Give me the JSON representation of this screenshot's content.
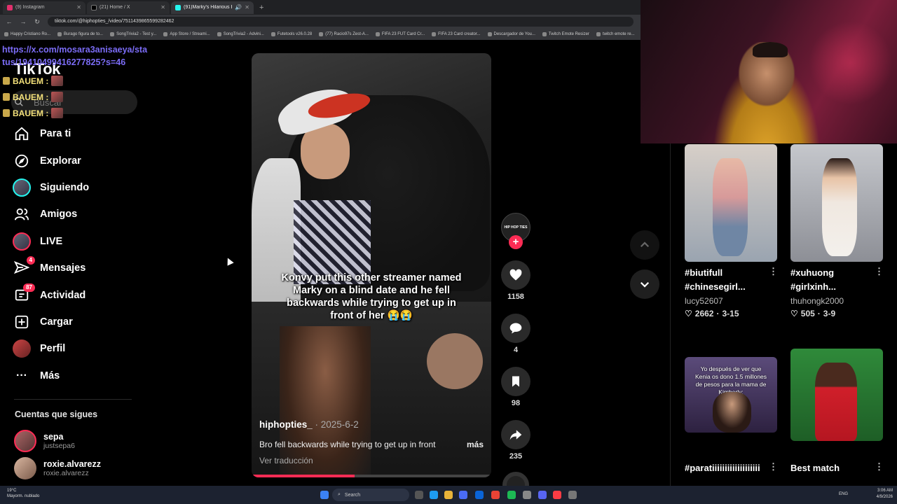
{
  "browser": {
    "tabs": [
      {
        "label": "(9) Instagram",
        "color": "#e1306c"
      },
      {
        "label": "(21) Home / X",
        "color": "#000000"
      },
      {
        "label": "(91)Marky's Hilarious Blind",
        "color": "#25f4ee"
      }
    ],
    "url": "tiktok.com/@hiphopties_/video/7511439865599282462",
    "bookmarks": [
      "Happy Cristiano Ro...",
      "Burago figura de to...",
      "SongTrivia2 - Test y...",
      "App Store / Streami...",
      "SongTrivia2 - Advini...",
      "Futetools v26.0.28",
      "(77) Racio97s Zest-A...",
      "FIFA 23 FUT Card Cr...",
      "FIFA 23 Card creator...",
      "Descargador de You...",
      "Twitch Emote Resizer",
      "twitch emote re..."
    ]
  },
  "overlay": {
    "link": "https://x.com/mosara3anisaeya/status/1941049941627782​5?s=46",
    "chat": [
      {
        "user": "BAUEM :"
      },
      {
        "user": "BAUEM :"
      },
      {
        "user": "BAUEM :"
      }
    ]
  },
  "sidebar": {
    "logo": "TikTok",
    "search_placeholder": "Buscar",
    "items": [
      {
        "label": "Para ti",
        "icon": "home-icon"
      },
      {
        "label": "Explorar",
        "icon": "compass-icon"
      },
      {
        "label": "Siguiendo",
        "icon": "following-avatar-icon"
      },
      {
        "label": "Amigos",
        "icon": "friends-icon"
      },
      {
        "label": "LIVE",
        "icon": "live-icon"
      },
      {
        "label": "Mensajes",
        "icon": "messages-icon",
        "badge": "4"
      },
      {
        "label": "Actividad",
        "icon": "activity-icon",
        "badge": "87"
      },
      {
        "label": "Cargar",
        "icon": "upload-icon"
      },
      {
        "label": "Perfil",
        "icon": "profile-icon"
      },
      {
        "label": "Más",
        "icon": "more-icon"
      }
    ],
    "following_title": "Cuentas que sigues",
    "accounts": [
      {
        "name": "sepa",
        "handle": "justsepa6",
        "live": true
      },
      {
        "name": "roxie.alvarezz",
        "handle": "roxie.alvarezz",
        "live": false
      }
    ]
  },
  "video": {
    "caption_overlay": "Konvy put this other streamer named Marky on a blind date and he fell backwards while trying to get up in front of her 😭😭",
    "author": "hiphopties_",
    "date": "· 2025-6-2",
    "description": "Bro fell backwards while trying to get up in front",
    "more": "más",
    "translate": "Ver traducción",
    "progress": 0.43,
    "avatar_text": "HIP HOP TIES",
    "likes": "1158",
    "comments": "4",
    "saves": "98",
    "shares": "235"
  },
  "related": [
    {
      "title_l1": "#biutifull",
      "title_l2": "#chinesegirl...",
      "user": "lucy52607",
      "likes": "2662",
      "date": "3-15"
    },
    {
      "title_l1": "#xuhuong",
      "title_l2": "#girlxinh...",
      "user": "thuhongk2000",
      "likes": "505",
      "date": "3-9"
    },
    {
      "title_l1": "#paratiiiiiiiiiiiiiiiiiii",
      "thumb_text": "Yo después de ver que Kenia os dono 1.5 millones de pesos para la mama de Kimberly:"
    },
    {
      "title_l1": "Best match"
    }
  ],
  "taskbar": {
    "weather_temp": "19°C",
    "weather_desc": "Mayorm. nublado",
    "search": "Search",
    "lang": "ENG",
    "time": "3:06 AM",
    "date": "4/9/2026"
  }
}
